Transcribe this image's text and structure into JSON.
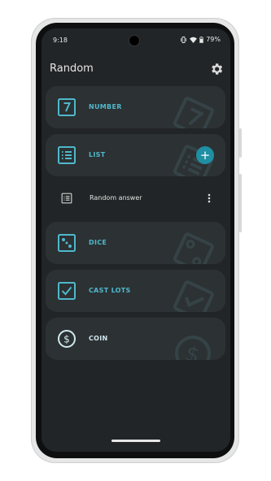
{
  "status_bar": {
    "time": "9:18",
    "battery": "79%"
  },
  "app_bar": {
    "title": "Random",
    "settings_icon": "gear-icon"
  },
  "cards": [
    {
      "label": "NUMBER",
      "icon": "number-seven-icon"
    },
    {
      "label": "LIST",
      "icon": "list-icon"
    },
    {
      "label": "DICE",
      "icon": "dice-icon"
    },
    {
      "label": "CAST LOTS",
      "icon": "checkbox-icon"
    },
    {
      "label": "COIN",
      "icon": "coin-dollar-icon"
    }
  ],
  "list_sub_item": {
    "label": "Random answer",
    "icon": "list-icon",
    "menu_icon": "more-vert-icon"
  },
  "fab": {
    "symbol": "+"
  },
  "colors": {
    "accent": "#4fb8cc",
    "fab": "#1f8fa3",
    "background": "#222527",
    "card": "#2c3133",
    "watermark": "#3e5358"
  }
}
